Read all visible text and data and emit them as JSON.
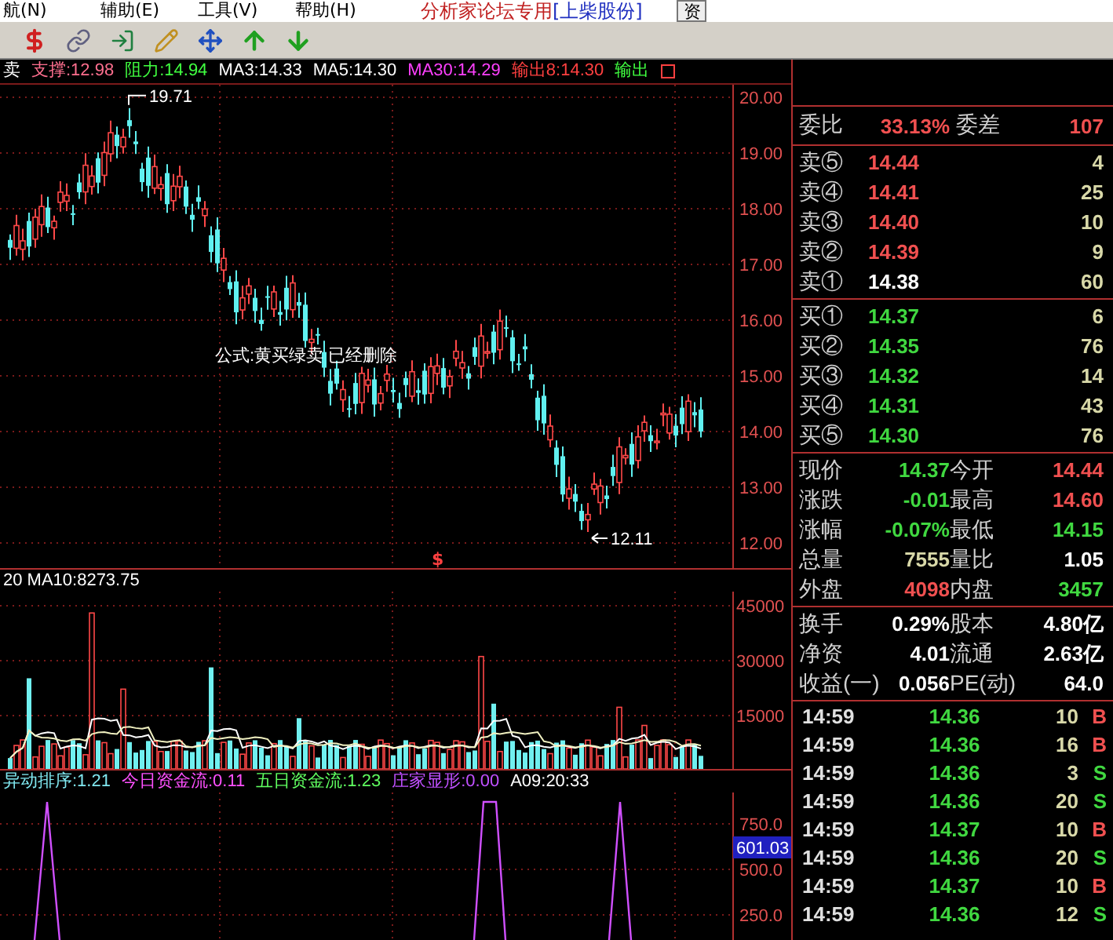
{
  "menu": [
    {
      "label": "航(N)"
    },
    {
      "label": "辅助(E)"
    },
    {
      "label": "工具(V)"
    },
    {
      "label": "帮助(H)"
    }
  ],
  "title": {
    "main": "分析家论坛专用",
    "stock": "[上柴股份]"
  },
  "side_tab": "资",
  "chart_header": [
    {
      "text": "卖",
      "color": "#ffffff"
    },
    {
      "text": "支撑:12.98",
      "color": "#ff6f8f"
    },
    {
      "text": "阻力:14.94",
      "color": "#40ff40"
    },
    {
      "text": "MA3:14.33",
      "color": "#ffffff"
    },
    {
      "text": "MA5:14.30",
      "color": "#ffffff"
    },
    {
      "text": "MA30:14.29",
      "color": "#ff40ff"
    },
    {
      "text": "输出8:14.30",
      "color": "#ff4040"
    },
    {
      "text": "输出",
      "color": "#40ff40"
    }
  ],
  "price_pane": {
    "axis_labels": [
      "20.00",
      "19.00",
      "18.00",
      "17.00",
      "16.00",
      "15.00",
      "14.00",
      "13.00",
      "12.00"
    ],
    "annotations": [
      {
        "kind": "high",
        "text": "19.71"
      },
      {
        "kind": "low",
        "text": "12.11"
      },
      {
        "kind": "note",
        "text": "公式:黄买绿卖 已经删除"
      },
      {
        "kind": "marker",
        "text": "$"
      }
    ]
  },
  "volume_pane": {
    "header": "20 MA10:8273.75",
    "axis_labels": [
      "45000",
      "30000",
      "15000"
    ]
  },
  "indicator_pane": {
    "header": [
      {
        "text": "异动排序:1.21",
        "color": "#80e8f0"
      },
      {
        "text": "今日资金流:0.11",
        "color": "#ff50ff"
      },
      {
        "text": "五日资金流:1.23",
        "color": "#60ff60"
      },
      {
        "text": "庄家显形:0.00",
        "color": "#c050ff"
      },
      {
        "text": "A09:20:33",
        "color": "#ffffff"
      }
    ],
    "axis_labels": [
      "750.0",
      "500.0",
      "250.0"
    ],
    "current_value": "601.03"
  },
  "order_book": {
    "ratio_label": "委比",
    "ratio": "33.13%",
    "diff_label": "委差",
    "diff": "107",
    "asks": [
      {
        "label": "卖⑤",
        "price": "14.44",
        "volume": "4",
        "color": "#f05050"
      },
      {
        "label": "卖④",
        "price": "14.41",
        "volume": "25",
        "color": "#f05050"
      },
      {
        "label": "卖③",
        "price": "14.40",
        "volume": "10",
        "color": "#f05050"
      },
      {
        "label": "卖②",
        "price": "14.39",
        "volume": "9",
        "color": "#f05050"
      },
      {
        "label": "卖①",
        "price": "14.38",
        "volume": "60",
        "color": "#ffffff"
      }
    ],
    "bids": [
      {
        "label": "买①",
        "price": "14.37",
        "volume": "6",
        "color": "#40d840"
      },
      {
        "label": "买②",
        "price": "14.35",
        "volume": "76",
        "color": "#40d840"
      },
      {
        "label": "买③",
        "price": "14.32",
        "volume": "14",
        "color": "#40d840"
      },
      {
        "label": "买④",
        "price": "14.31",
        "volume": "43",
        "color": "#40d840"
      },
      {
        "label": "买⑤",
        "price": "14.30",
        "volume": "76",
        "color": "#40d840"
      }
    ]
  },
  "quote_stats": [
    [
      {
        "label": "现价",
        "value": "14.37",
        "color": "#40d840"
      },
      {
        "label": "今开",
        "value": "14.44",
        "color": "#f05050"
      }
    ],
    [
      {
        "label": "涨跌",
        "value": "-0.01",
        "color": "#40d840"
      },
      {
        "label": "最高",
        "value": "14.60",
        "color": "#f05050"
      }
    ],
    [
      {
        "label": "涨幅",
        "value": "-0.07%",
        "color": "#40d840"
      },
      {
        "label": "最低",
        "value": "14.15",
        "color": "#40d840"
      }
    ],
    [
      {
        "label": "总量",
        "value": "7555",
        "color": "#d8d8a8"
      },
      {
        "label": "量比",
        "value": "1.05",
        "color": "#ffffff"
      }
    ],
    [
      {
        "label": "外盘",
        "value": "4098",
        "color": "#f05050"
      },
      {
        "label": "内盘",
        "value": "3457",
        "color": "#40d840"
      }
    ]
  ],
  "share_stats": [
    [
      {
        "label": "换手",
        "value": "0.29%"
      },
      {
        "label": "股本",
        "value": "4.80亿"
      }
    ],
    [
      {
        "label": "净资",
        "value": "4.01"
      },
      {
        "label": "流通",
        "value": "2.63亿"
      }
    ],
    [
      {
        "label": "收益(一)",
        "value": "0.056"
      },
      {
        "label": "PE(动)",
        "value": "64.0"
      }
    ]
  ],
  "ticks": [
    {
      "time": "14:59",
      "price": "14.36",
      "volume": "10",
      "side": "B",
      "color": "#f05050"
    },
    {
      "time": "14:59",
      "price": "14.36",
      "volume": "16",
      "side": "B",
      "color": "#f05050"
    },
    {
      "time": "14:59",
      "price": "14.36",
      "volume": "3",
      "side": "S",
      "color": "#40d840"
    },
    {
      "time": "14:59",
      "price": "14.36",
      "volume": "20",
      "side": "S",
      "color": "#40d840"
    },
    {
      "time": "14:59",
      "price": "14.37",
      "volume": "10",
      "side": "B",
      "color": "#f05050"
    },
    {
      "time": "14:59",
      "price": "14.36",
      "volume": "20",
      "side": "S",
      "color": "#40d840"
    },
    {
      "time": "14:59",
      "price": "14.37",
      "volume": "10",
      "side": "B",
      "color": "#f05050"
    },
    {
      "time": "14:59",
      "price": "14.36",
      "volume": "12",
      "side": "S",
      "color": "#40d840"
    }
  ]
}
